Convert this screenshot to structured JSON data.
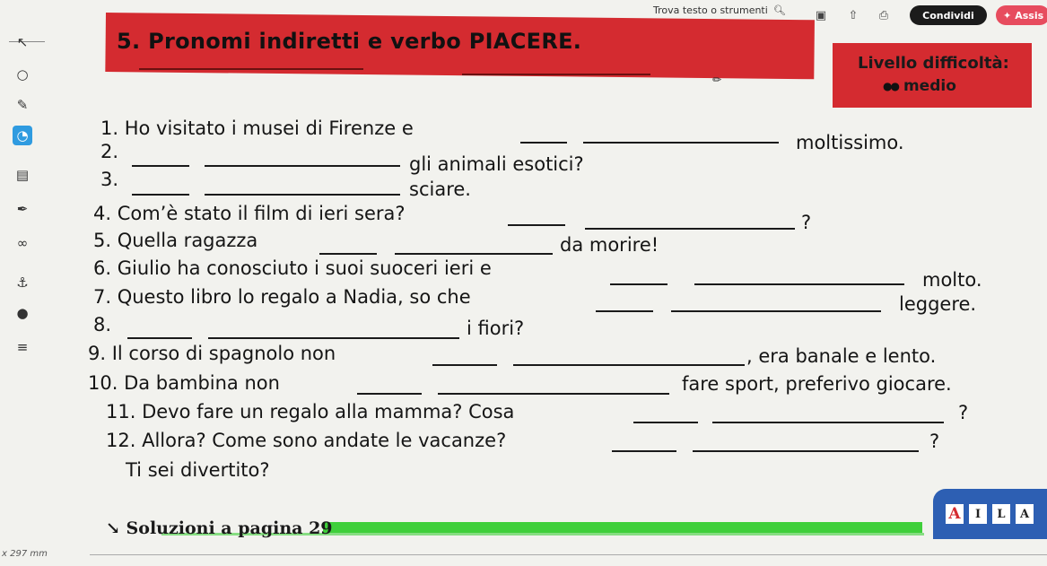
{
  "toolbar": {
    "search_label": "Trova testo o strumenti",
    "share_label": "Condividi",
    "assist_label": "Assis"
  },
  "header": {
    "title": "5. Pronomi indiretti e verbo PIACERE.",
    "level_label": "Livello difficoltà:",
    "level_value": "medio"
  },
  "exercise": {
    "lines": [
      {
        "a": "1. Ho visitato i musei di Firenze e",
        "b": "moltissimo."
      },
      {
        "a": "2.",
        "b": "gli animali esotici?"
      },
      {
        "a": "3.",
        "b": "sciare."
      },
      {
        "a": "4. Com’è stato il film di ieri sera?",
        "b": "?"
      },
      {
        "a": "5. Quella ragazza",
        "b": "da morire!"
      },
      {
        "a": "6. Giulio ha conosciuto i suoi suoceri ieri e",
        "b": "molto."
      },
      {
        "a": "7. Questo libro lo regalo a Nadia, so che",
        "b": "leggere."
      },
      {
        "a": "8.",
        "b": "i fiori?"
      },
      {
        "a": "9. Il corso di spagnolo non",
        "b": ", era banale e lento."
      },
      {
        "a": "10. Da bambina non",
        "b": "fare sport, preferivo giocare."
      },
      {
        "a": "11. Devo fare un regalo alla mamma? Cosa",
        "b": "?"
      },
      {
        "a": "12. Allora? Come sono andate le vacanze?",
        "b": "?"
      },
      {
        "a": "Ti sei divertito?",
        "b": ""
      }
    ]
  },
  "footer": {
    "solutions": "Soluzioni a pagina 29",
    "dimension": "x 297 mm",
    "logo_letters": [
      "A",
      "I",
      "L",
      "A"
    ]
  }
}
